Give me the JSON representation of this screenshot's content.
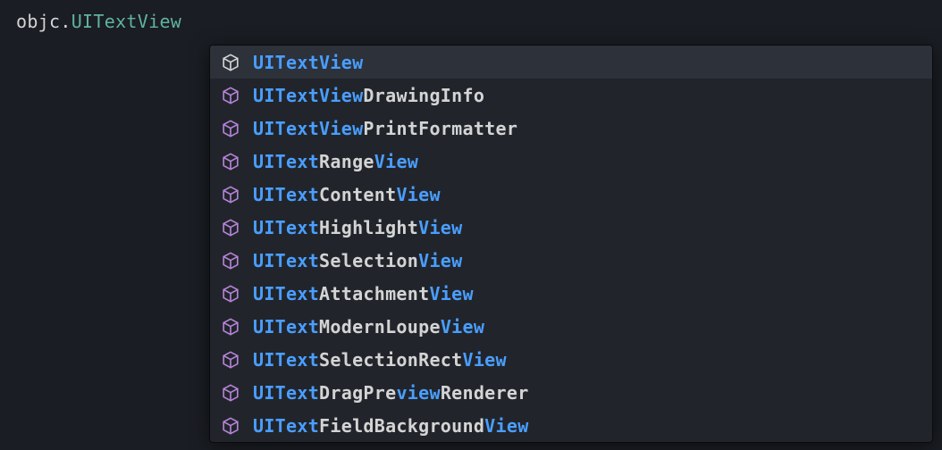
{
  "editor": {
    "module": "objc",
    "dot": ".",
    "member": "UITextView"
  },
  "completion": {
    "query": "UITextView",
    "selectedIndex": 0,
    "items": [
      {
        "segments": [
          {
            "text": "UITextView",
            "match": true
          }
        ],
        "iconVariant": "white"
      },
      {
        "segments": [
          {
            "text": "UITextView",
            "match": true
          },
          {
            "text": "DrawingInfo",
            "match": false
          }
        ],
        "iconVariant": "purple"
      },
      {
        "segments": [
          {
            "text": "UITextView",
            "match": true
          },
          {
            "text": "PrintFormatter",
            "match": false
          }
        ],
        "iconVariant": "purple"
      },
      {
        "segments": [
          {
            "text": "UIText",
            "match": true
          },
          {
            "text": "Range",
            "match": false
          },
          {
            "text": "View",
            "match": true
          }
        ],
        "iconVariant": "purple"
      },
      {
        "segments": [
          {
            "text": "UIText",
            "match": true
          },
          {
            "text": "Content",
            "match": false
          },
          {
            "text": "View",
            "match": true
          }
        ],
        "iconVariant": "purple"
      },
      {
        "segments": [
          {
            "text": "UIText",
            "match": true
          },
          {
            "text": "Highlight",
            "match": false
          },
          {
            "text": "View",
            "match": true
          }
        ],
        "iconVariant": "purple"
      },
      {
        "segments": [
          {
            "text": "UIText",
            "match": true
          },
          {
            "text": "Selection",
            "match": false
          },
          {
            "text": "View",
            "match": true
          }
        ],
        "iconVariant": "purple"
      },
      {
        "segments": [
          {
            "text": "UIText",
            "match": true
          },
          {
            "text": "Attachment",
            "match": false
          },
          {
            "text": "View",
            "match": true
          }
        ],
        "iconVariant": "purple"
      },
      {
        "segments": [
          {
            "text": "UIText",
            "match": true
          },
          {
            "text": "ModernLoupe",
            "match": false
          },
          {
            "text": "View",
            "match": true
          }
        ],
        "iconVariant": "purple"
      },
      {
        "segments": [
          {
            "text": "UIText",
            "match": true
          },
          {
            "text": "SelectionRect",
            "match": false
          },
          {
            "text": "View",
            "match": true
          }
        ],
        "iconVariant": "purple"
      },
      {
        "segments": [
          {
            "text": "UIText",
            "match": true
          },
          {
            "text": "DragPre",
            "match": false
          },
          {
            "text": "view",
            "match": true
          },
          {
            "text": "Renderer",
            "match": false
          }
        ],
        "iconVariant": "purple"
      },
      {
        "segments": [
          {
            "text": "UIText",
            "match": true
          },
          {
            "text": "FieldBackground",
            "match": false
          },
          {
            "text": "View",
            "match": true
          }
        ],
        "iconVariant": "purple"
      }
    ]
  },
  "colors": {
    "iconPurple": "#b683d8",
    "iconWhite": "#d4d4d4",
    "matchBlue": "#4a9eff"
  }
}
